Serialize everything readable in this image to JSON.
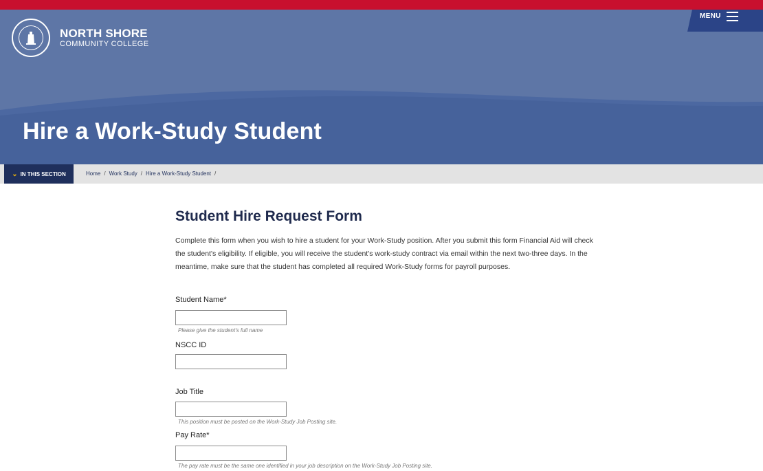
{
  "college": {
    "name": "NORTH SHORE",
    "sub": "COMMUNITY COLLEGE"
  },
  "header": {
    "menu_label": "MENU",
    "hero_title": "Hire a Work-Study Student"
  },
  "colors": {
    "brand_red": "#c8102e",
    "hero_blue": "#5e76a6",
    "navy": "#1f2f5c",
    "accent_yellow": "#f2b705"
  },
  "section_nav": {
    "label": "IN THIS SECTION"
  },
  "breadcrumb": [
    "Home",
    "Work Study",
    "Hire a Work-Study Student"
  ],
  "form": {
    "title": "Student Hire Request Form",
    "intro": "Complete this form when you wish to hire a student for your Work-Study position. After you submit this form Financial Aid will check the student's eligibility. If eligible, you will receive the student's work-study contract via email within the next two-three days. In the meantime, make sure that the student has completed all required Work-Study forms for payroll purposes.",
    "fields": {
      "student_name": {
        "label": "Student Name*",
        "value": "",
        "hint": "Please give the student's full name"
      },
      "nscc_id": {
        "label": "NSCC ID",
        "value": ""
      },
      "job_title": {
        "label": "Job Title",
        "value": "",
        "hint": "This position must be posted on the Work-Study Job Posting site."
      },
      "pay_rate": {
        "label": "Pay Rate*",
        "value": "",
        "hint": "The pay rate must be the same one identified in your job description on the Work-Study Job Posting site."
      }
    }
  }
}
